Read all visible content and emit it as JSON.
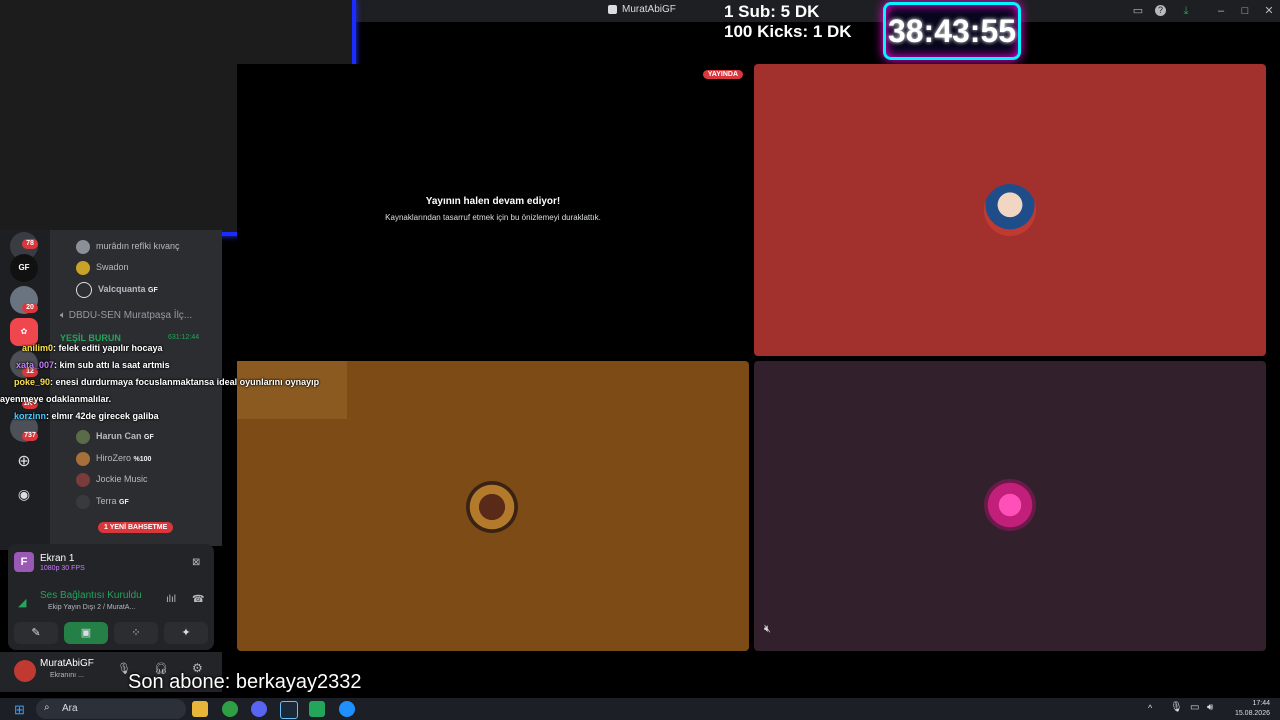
{
  "window": {
    "title": "MuratAbiGF"
  },
  "counters": {
    "line1": "1 Sub: 5 DK",
    "line2": "100 Kicks: 1 DK",
    "timer": "38:43:55"
  },
  "stage": {
    "paused_title": "Yayının halen devam ediyor!",
    "paused_sub": "Kaynaklarından tasarruf etmek için bu önizlemeyi duraklattık.",
    "live_badge": "YAYINDA"
  },
  "rail": {
    "badges": [
      "78",
      "20",
      "12",
      "1K+",
      "737"
    ]
  },
  "channels": {
    "members_top": [
      {
        "name": "murâdın refîki kıvanç",
        "tag": ""
      },
      {
        "name": "Swadon",
        "tag": ""
      },
      {
        "name": "Valcquanta",
        "tag": "GF"
      }
    ],
    "voice_channel": "DBDU-SEN Muratpaşa İlç...",
    "channel_time": "631:12:44",
    "channel_partial": "YEŞİL BURUN",
    "members_bottom": [
      {
        "name": "Harun Can",
        "tag": "GF"
      },
      {
        "name": "HiroZero",
        "tag": "%100"
      },
      {
        "name": "Jockie Music",
        "tag": ""
      },
      {
        "name": "Terra",
        "tag": "GF"
      }
    ],
    "mention_pill": "1 YENİ BAHSETME"
  },
  "chat": [
    {
      "user": "anilim0",
      "text": ": felek editi yapılır hocaya",
      "color": "#ffe34d"
    },
    {
      "user": "xata_007",
      "text": ": kim sub attı la saat artmis",
      "color": "#c77dff"
    },
    {
      "user": "poke_90",
      "text": ": enesi durdurmaya focuslanmaktansa ideal oyunlarını oynayıp",
      "color": "#ffe34d"
    },
    {
      "user": "",
      "text": "ayenmeye odaklanmalılar.",
      "color": "#ffffff"
    },
    {
      "user": "korzinn",
      "text": ": elmır 42de girecek galiba",
      "color": "#45c9ff"
    }
  ],
  "voice_panel": {
    "screen_title": "Ekran 1",
    "screen_quality": "1080p 30 FPS",
    "status": "Ses Bağlantısı Kuruldu",
    "channel": "Ekip Yayın Dışı 2 / MuratA..."
  },
  "user": {
    "name": "MuratAbiGF",
    "status": "Ekranını ..."
  },
  "last_sub": "Son abone: berkayay2332",
  "taskbar": {
    "search": "Ara",
    "time": "17:44",
    "date": "15.08.2026"
  },
  "colors": {
    "accent": "#1a2cff",
    "timer_glow": "#ff00e6",
    "timer_border": "#00f5ff",
    "live": "#da373c",
    "tile_red": "#a2302d",
    "tile_orange": "#7d4c16",
    "tile_plum": "#32212d",
    "voice_green": "#23a55a"
  }
}
